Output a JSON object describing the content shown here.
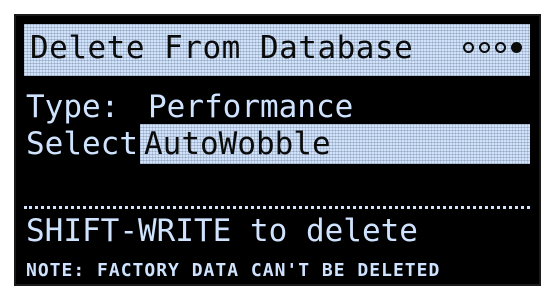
{
  "header": {
    "title": "Delete From Database",
    "page_indicator": {
      "total": 4,
      "active": 4
    }
  },
  "fields": {
    "type_label": "Type:",
    "type_value": "Performance",
    "select_label": "Select:",
    "select_value": "AutoWobble"
  },
  "hint": "SHIFT-WRITE to delete",
  "note": "NOTE: FACTORY DATA CAN'T BE DELETED",
  "colors": {
    "screen_bg": "#000000",
    "pixel_fg": "#cfe3ff",
    "inverted_text": "#0b0b0b"
  }
}
